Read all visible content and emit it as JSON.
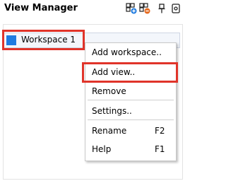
{
  "panel": {
    "title": "View Manager"
  },
  "header_icons": [
    "add-view-icon",
    "remove-view-icon",
    "pin-icon",
    "settings-icon"
  ],
  "workspace": {
    "label": "Workspace 1",
    "color": "#1f7be0"
  },
  "menu": {
    "items": [
      {
        "label": "Add workspace..",
        "shortcut": ""
      },
      {
        "label": "Add view..",
        "shortcut": ""
      },
      {
        "label": "Remove",
        "shortcut": ""
      },
      {
        "label": "Settings..",
        "shortcut": ""
      },
      {
        "label": "Rename",
        "shortcut": "F2"
      },
      {
        "label": "Help",
        "shortcut": "F1"
      }
    ]
  },
  "colors": {
    "highlight": "#e0342a",
    "accent_blue": "#1f7be0",
    "remove_orange": "#e56a1f"
  }
}
